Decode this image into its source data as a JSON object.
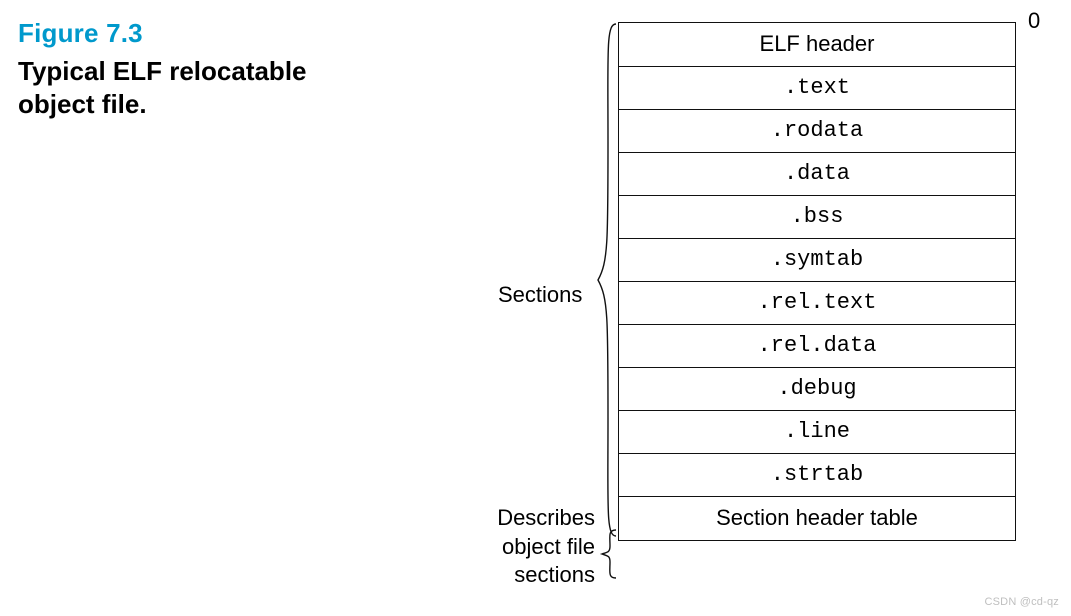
{
  "figure": {
    "label": "Figure 7.3",
    "title": "Typical ELF relocatable object file."
  },
  "zero_label": "0",
  "labels": {
    "sections": "Sections",
    "describes": "Describes object file sections"
  },
  "rows": {
    "r0": "ELF header",
    "r1": ".text",
    "r2": ".rodata",
    "r3": ".data",
    "r4": ".bss",
    "r5": ".symtab",
    "r6": ".rel.text",
    "r7": ".rel.data",
    "r8": ".debug",
    "r9": ".line",
    "r10": ".strtab",
    "r11": "Section header table"
  },
  "watermark": "CSDN @cd-qz",
  "chart_data": {
    "type": "table",
    "title": "Typical ELF relocatable object file.",
    "sections_brace_covers": [
      0,
      1,
      2,
      3,
      4,
      5,
      6,
      7,
      8,
      9,
      10
    ],
    "describes_brace_covers": [
      11
    ],
    "rows": [
      {
        "name": "ELF header",
        "style": "sans"
      },
      {
        "name": ".text",
        "style": "mono"
      },
      {
        "name": ".rodata",
        "style": "mono"
      },
      {
        "name": ".data",
        "style": "mono"
      },
      {
        "name": ".bss",
        "style": "mono"
      },
      {
        "name": ".symtab",
        "style": "mono"
      },
      {
        "name": ".rel.text",
        "style": "mono"
      },
      {
        "name": ".rel.data",
        "style": "mono"
      },
      {
        "name": ".debug",
        "style": "mono"
      },
      {
        "name": ".line",
        "style": "mono"
      },
      {
        "name": ".strtab",
        "style": "mono"
      },
      {
        "name": "Section header table",
        "style": "sans"
      }
    ],
    "annotations": {
      "top_right": "0",
      "left_mid": "Sections",
      "left_bottom": "Describes object file sections"
    }
  }
}
